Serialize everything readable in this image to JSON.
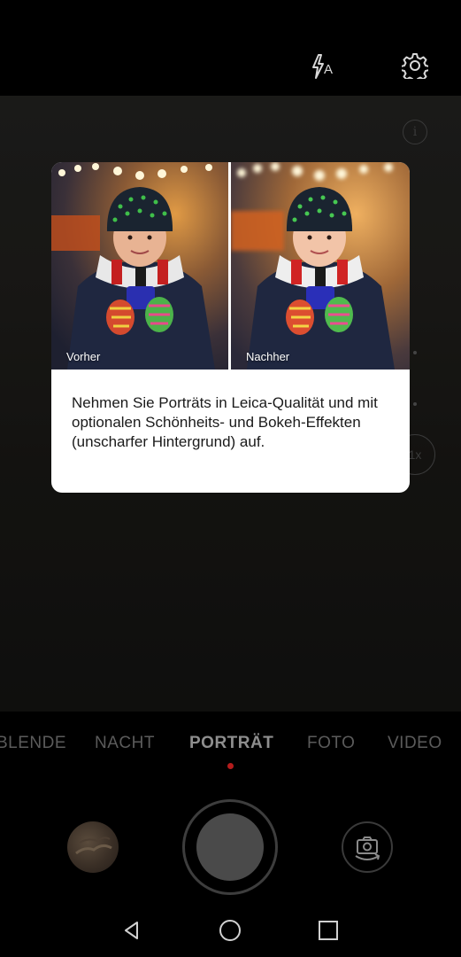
{
  "topbar": {
    "flash_icon": "flash-auto-icon",
    "flash_label": "A",
    "settings_icon": "gear-icon"
  },
  "viewfinder": {
    "info_icon": "info-icon",
    "zoom_label": "1x"
  },
  "dialog": {
    "before_label": "Vorher",
    "after_label": "Nachher",
    "description": "Nehmen Sie Porträts in Leica-Qualität und mit optionalen Schönheits- und Bokeh-Effekten (unscharfer Hintergrund) auf."
  },
  "modes": {
    "items": [
      "BLENDE",
      "NACHT",
      "PORTRÄT",
      "FOTO",
      "VIDEO"
    ],
    "active": "PORTRÄT"
  },
  "controls": {
    "gallery_icon": "gallery-thumbnail",
    "shutter_icon": "shutter-button",
    "switch_icon": "switch-camera-icon"
  },
  "navbar": {
    "back_icon": "back-icon",
    "home_icon": "home-icon",
    "recents_icon": "recents-icon"
  },
  "colors": {
    "accent_dot": "#b41c1c",
    "mode_inactive": "#5b5b5b",
    "mode_active": "#8e8e8e"
  }
}
